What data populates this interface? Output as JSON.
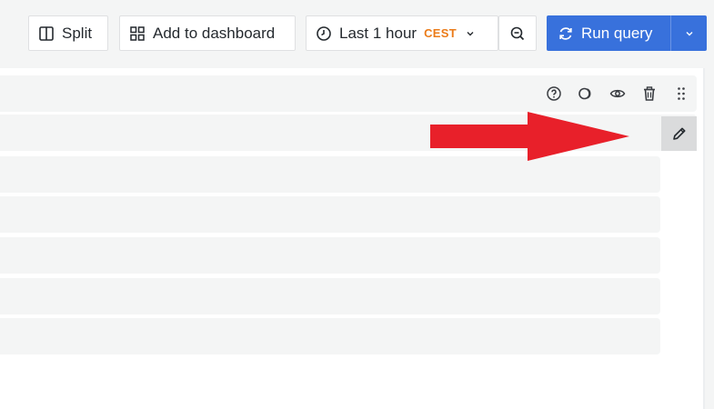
{
  "toolbar": {
    "split_label": "Split",
    "add_to_dashboard_label": "Add to dashboard",
    "time_range_label": "Last 1 hour",
    "timezone_badge": "CEST",
    "run_query_label": "Run query"
  },
  "colors": {
    "accent": "#3871dc",
    "timezone": "#eb7b18",
    "arrow": "#e8202a",
    "row_bg": "#f4f5f5"
  },
  "icons": {
    "split": "split-icon",
    "dashboard": "dashboard-grid-icon",
    "clock": "clock-icon",
    "zoom_out": "zoom-out-icon",
    "refresh": "refresh-icon",
    "help": "help-icon",
    "copy": "duplicate-icon",
    "eye": "eye-icon",
    "trash": "trash-icon",
    "drag": "drag-handle-icon",
    "edit": "pencil-icon"
  }
}
